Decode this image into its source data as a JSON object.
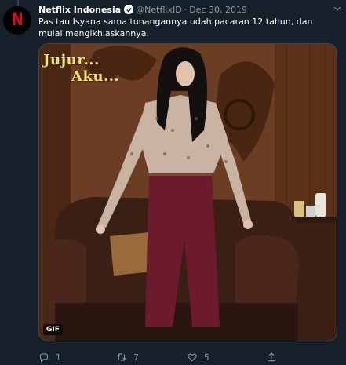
{
  "tweet": {
    "author_name": "Netflix Indonesia",
    "handle": "@NetflixID",
    "separator": "·",
    "date": "Dec 30, 2019",
    "text": "Pas tau Isyana sama tunangannya udah pacaran 12 tahun, dan mulai mengikhlaskannya.",
    "avatar_letter": "N",
    "verified": true
  },
  "media": {
    "caption_line1": "Jujur...",
    "caption_line2": "Aku...",
    "badge": "GIF"
  },
  "actions": {
    "reply_count": "1",
    "retweet_count": "7",
    "like_count": "5"
  },
  "colors": {
    "background": "#15202b",
    "secondary_text": "#8899a6",
    "netflix_red": "#e50914",
    "caption_yellow": "#f5e36b"
  },
  "icons": [
    "reply-icon",
    "retweet-icon",
    "like-icon",
    "share-icon",
    "verified-badge-icon",
    "more-icon"
  ]
}
